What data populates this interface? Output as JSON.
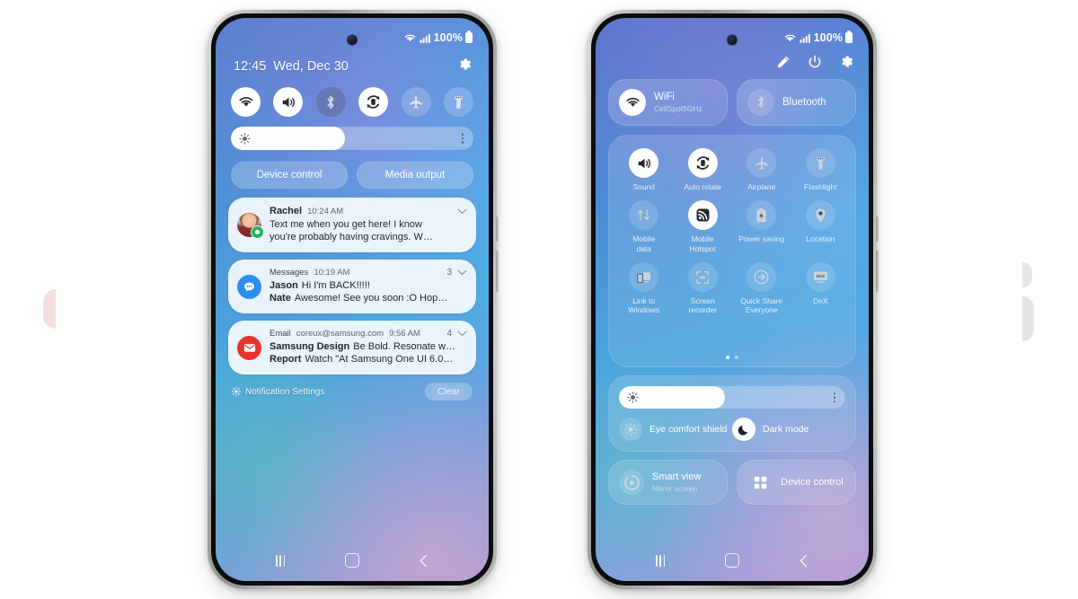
{
  "left_phone": {
    "status": {
      "battery": "100%",
      "wifi_icon": "wifi-icon",
      "signal_icon": "signal-icon",
      "battery_icon": "battery-icon"
    },
    "clock": {
      "time": "12:45",
      "date": "Wed, Dec 30"
    },
    "settings_icon": "gear-icon",
    "toggles": [
      {
        "name": "wifi",
        "icon": "wifi-icon",
        "state": "on"
      },
      {
        "name": "sound",
        "icon": "sound-icon",
        "state": "on"
      },
      {
        "name": "bluetooth",
        "icon": "bluetooth-icon",
        "state": "off"
      },
      {
        "name": "auto-rotate",
        "icon": "auto-rotate-icon",
        "state": "on"
      },
      {
        "name": "airplane",
        "icon": "airplane-icon",
        "state": "off"
      },
      {
        "name": "flashlight",
        "icon": "flashlight-icon",
        "state": "off"
      }
    ],
    "brightness": {
      "icon": "brightness-icon",
      "level": 47,
      "more_icon": "more-vertical-icon"
    },
    "pills": [
      {
        "label": "Device control"
      },
      {
        "label": "Media output"
      }
    ],
    "notifications": [
      {
        "app": "Rachel",
        "app_bold": true,
        "time": "10:24 AM",
        "count": "",
        "avatar": "photo-avatar",
        "badge": "messenger-badge",
        "line1": "Text me when you get here! I know",
        "line2": "you're probably having cravings. W…",
        "sender1": "",
        "sender2": ""
      },
      {
        "app": "Messages",
        "app_bold": false,
        "time": "10:19 AM",
        "count": "3",
        "avatar": "message-icon",
        "sender1": "Jason",
        "line1": "Hi I'm BACK!!!!!",
        "sender2": "Nate",
        "line2": "Awesome! See you soon :O Hop…"
      },
      {
        "app": "Email",
        "app_bold": false,
        "account": "coreux@samsung.com",
        "time": "9:56 AM",
        "count": "4",
        "avatar": "mail-icon",
        "sender1": "Samsung Design",
        "line1": "Be Bold. Resonate w…",
        "sender2": "Report",
        "line2": "Watch \"At Samsung One UI 6.0…"
      }
    ],
    "footer": {
      "settings_icon": "gear-small-icon",
      "settings_label": "Notification Settings",
      "clear_label": "Clear"
    },
    "nav": {
      "recent": "recents-icon",
      "home": "home-icon",
      "back": "back-icon"
    }
  },
  "right_phone": {
    "status": {
      "battery": "100%"
    },
    "top_actions": [
      {
        "name": "edit",
        "icon": "pencil-icon"
      },
      {
        "name": "power",
        "icon": "power-icon"
      },
      {
        "name": "settings",
        "icon": "gear-icon"
      }
    ],
    "dual_cards": [
      {
        "title": "WiFi",
        "subtitle": "CellSpot5GHz",
        "icon": "wifi-icon",
        "state": "on"
      },
      {
        "title": "Bluetooth",
        "subtitle": "",
        "icon": "bluetooth-icon",
        "state": "off"
      }
    ],
    "grid": [
      {
        "label": "Sound",
        "icon": "sound-icon",
        "state": "on"
      },
      {
        "label": "Auto rotate",
        "icon": "auto-rotate-icon",
        "state": "on"
      },
      {
        "label": "Airplane",
        "icon": "airplane-icon",
        "state": "off"
      },
      {
        "label": "Flashlight",
        "icon": "flashlight-icon",
        "state": "off"
      },
      {
        "label": "Mobile\ndata",
        "icon": "mobile-data-icon",
        "state": "off"
      },
      {
        "label": "Mobile\nHotspot",
        "icon": "hotspot-icon",
        "state": "on"
      },
      {
        "label": "Power saving",
        "icon": "power-saving-icon",
        "state": "off"
      },
      {
        "label": "Location",
        "icon": "location-icon",
        "state": "off"
      },
      {
        "label": "Link to\nWindows",
        "icon": "link-to-windows-icon",
        "state": "off"
      },
      {
        "label": "Screen\nrecorder",
        "icon": "screen-recorder-icon",
        "state": "off"
      },
      {
        "label": "Quick Share\nEveryone",
        "icon": "quick-share-icon",
        "state": "off"
      },
      {
        "label": "DeX",
        "icon": "dex-icon",
        "state": "off"
      }
    ],
    "page_dots": {
      "total": 2,
      "active": 1
    },
    "brightness": {
      "icon": "brightness-icon",
      "level": 47,
      "more_icon": "more-vertical-icon"
    },
    "modes": [
      {
        "label": "Eye comfort shield",
        "icon": "eye-comfort-icon",
        "state": "off"
      },
      {
        "label": "Dark mode",
        "icon": "moon-icon",
        "state": "on"
      }
    ],
    "bottom_cards": [
      {
        "title": "Smart view",
        "subtitle": "Mirror screen",
        "icon": "smart-view-icon"
      },
      {
        "title": "Device control",
        "subtitle": "",
        "icon": "grid-4-icon"
      }
    ],
    "nav": {
      "recent": "recents-icon",
      "home": "home-icon",
      "back": "back-icon"
    }
  },
  "colors": {
    "accent_white": "#ffffff",
    "panel_glass": "rgba(255,255,255,0.16)",
    "notif_bg": "#f5fafd",
    "msg_blue": "#2b8ff0",
    "mail_red": "#e8342e",
    "badge_green": "#19b85a"
  }
}
